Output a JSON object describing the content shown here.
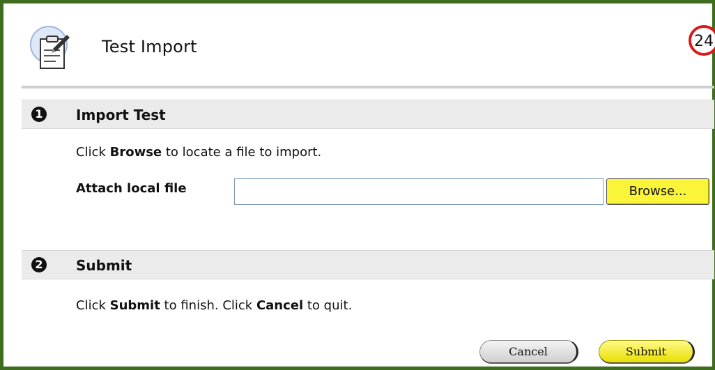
{
  "header": {
    "title": "Test Import",
    "step_number": "24",
    "icon": "clipboard-pencil-icon"
  },
  "sections": [
    {
      "number": "1",
      "title": "Import Test",
      "instruction": {
        "pre": "Click ",
        "bold": "Browse",
        "post": " to locate a file to import."
      },
      "field_label": "Attach local file",
      "file_input_value": "",
      "browse_label": "Browse..."
    },
    {
      "number": "2",
      "title": "Submit",
      "instruction": {
        "pre": "Click ",
        "bold1": "Submit",
        "mid": " to finish. Click ",
        "bold2": "Cancel",
        "post": " to quit."
      }
    }
  ],
  "buttons": {
    "cancel_label": "Cancel",
    "submit_label": "Submit"
  },
  "colors": {
    "frame_border": "#3e6d1f",
    "section_bar": "#ebebeb",
    "button_yellow": "#fbf53a",
    "badge_red": "#d81b1b"
  }
}
